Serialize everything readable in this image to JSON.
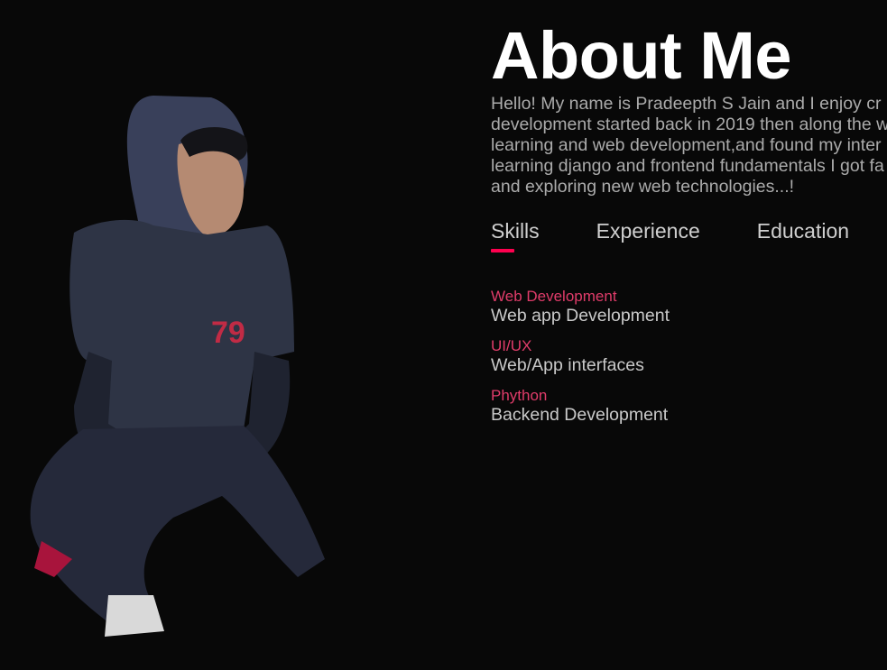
{
  "about": {
    "title": "About Me",
    "bio_lines": [
      "Hello! My name is Pradeepth S Jain and I enjoy cr",
      "development started back in 2019 then along the w",
      "learning and web development,and found my inter",
      "learning django and frontend fundamentals I got fa",
      "and exploring new web technologies...!"
    ]
  },
  "tabs": [
    {
      "label": "Skills",
      "active": true
    },
    {
      "label": "Experience",
      "active": false
    },
    {
      "label": "Education",
      "active": false
    }
  ],
  "skills": [
    {
      "name": "Web Development",
      "desc": "Web app Development"
    },
    {
      "name": "UI/UX",
      "desc": "Web/App interfaces"
    },
    {
      "name": "Phython",
      "desc": "Backend Development"
    }
  ],
  "colors": {
    "background": "#080808",
    "accent": "#ff004f",
    "skill_name": "#e03c6a",
    "hoodie": "#2e3445",
    "jeans": "#25293a"
  },
  "photo": {
    "shirt_text": "79"
  }
}
